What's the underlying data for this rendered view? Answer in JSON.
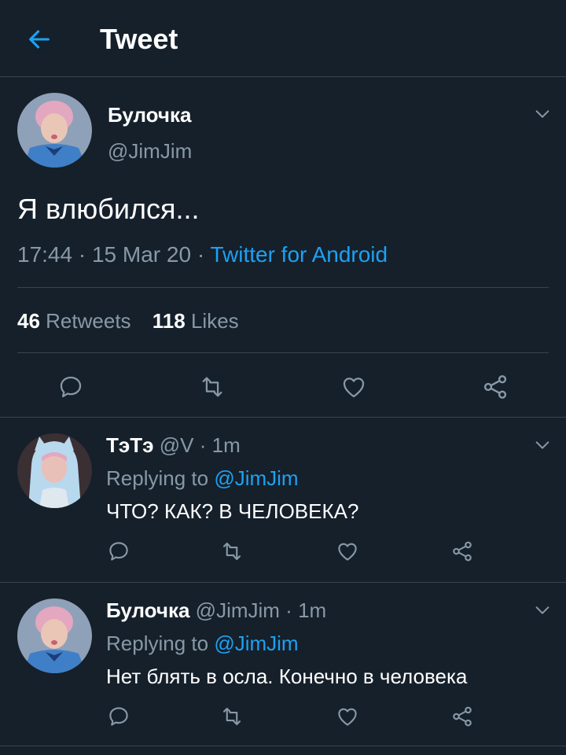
{
  "header": {
    "title": "Tweet",
    "back_icon": "arrow-left-icon"
  },
  "tweet": {
    "author_name": "Булочка",
    "author_handle": "@JimJim",
    "text": "Я влюбился...",
    "time": "17:44",
    "date": "15 Mar 20",
    "source": "Twitter for Android",
    "retweets_count": "46",
    "retweets_label": "Retweets",
    "likes_count": "118",
    "likes_label": "Likes"
  },
  "replies": [
    {
      "name": "ТэТэ",
      "handle": "@V",
      "time": "1m",
      "replying_prefix": "Replying to",
      "replying_to": "@JimJim",
      "text": "ЧТО? КАК? В ЧЕЛОВЕКА?"
    },
    {
      "name": "Булочка",
      "handle": "@JimJim",
      "time": "1m",
      "replying_prefix": "Replying to",
      "replying_to": "@JimJim",
      "text": "Нет блять в осла. Конечно в человека"
    }
  ],
  "separator": "·",
  "colors": {
    "background": "#15202b",
    "accent": "#1da1f2",
    "secondary_text": "#8899a6",
    "border": "#38444d"
  },
  "icons": [
    "arrow-left-icon",
    "chevron-down-icon",
    "reply-icon",
    "retweet-icon",
    "like-icon",
    "share-icon"
  ]
}
